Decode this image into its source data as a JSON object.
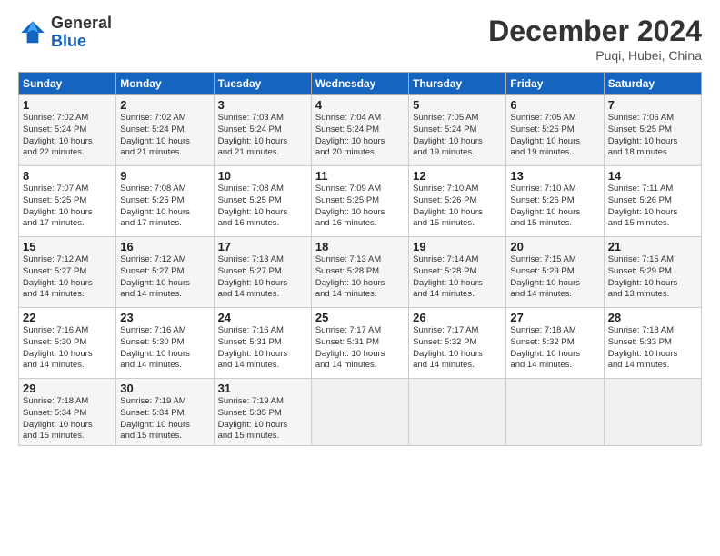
{
  "header": {
    "logo_general": "General",
    "logo_blue": "Blue",
    "month_title": "December 2024",
    "location": "Puqi, Hubei, China"
  },
  "days_of_week": [
    "Sunday",
    "Monday",
    "Tuesday",
    "Wednesday",
    "Thursday",
    "Friday",
    "Saturday"
  ],
  "weeks": [
    [
      {
        "day": "1",
        "info": "Sunrise: 7:02 AM\nSunset: 5:24 PM\nDaylight: 10 hours\nand 22 minutes."
      },
      {
        "day": "2",
        "info": "Sunrise: 7:02 AM\nSunset: 5:24 PM\nDaylight: 10 hours\nand 21 minutes."
      },
      {
        "day": "3",
        "info": "Sunrise: 7:03 AM\nSunset: 5:24 PM\nDaylight: 10 hours\nand 21 minutes."
      },
      {
        "day": "4",
        "info": "Sunrise: 7:04 AM\nSunset: 5:24 PM\nDaylight: 10 hours\nand 20 minutes."
      },
      {
        "day": "5",
        "info": "Sunrise: 7:05 AM\nSunset: 5:24 PM\nDaylight: 10 hours\nand 19 minutes."
      },
      {
        "day": "6",
        "info": "Sunrise: 7:05 AM\nSunset: 5:25 PM\nDaylight: 10 hours\nand 19 minutes."
      },
      {
        "day": "7",
        "info": "Sunrise: 7:06 AM\nSunset: 5:25 PM\nDaylight: 10 hours\nand 18 minutes."
      }
    ],
    [
      {
        "day": "8",
        "info": "Sunrise: 7:07 AM\nSunset: 5:25 PM\nDaylight: 10 hours\nand 17 minutes."
      },
      {
        "day": "9",
        "info": "Sunrise: 7:08 AM\nSunset: 5:25 PM\nDaylight: 10 hours\nand 17 minutes."
      },
      {
        "day": "10",
        "info": "Sunrise: 7:08 AM\nSunset: 5:25 PM\nDaylight: 10 hours\nand 16 minutes."
      },
      {
        "day": "11",
        "info": "Sunrise: 7:09 AM\nSunset: 5:25 PM\nDaylight: 10 hours\nand 16 minutes."
      },
      {
        "day": "12",
        "info": "Sunrise: 7:10 AM\nSunset: 5:26 PM\nDaylight: 10 hours\nand 15 minutes."
      },
      {
        "day": "13",
        "info": "Sunrise: 7:10 AM\nSunset: 5:26 PM\nDaylight: 10 hours\nand 15 minutes."
      },
      {
        "day": "14",
        "info": "Sunrise: 7:11 AM\nSunset: 5:26 PM\nDaylight: 10 hours\nand 15 minutes."
      }
    ],
    [
      {
        "day": "15",
        "info": "Sunrise: 7:12 AM\nSunset: 5:27 PM\nDaylight: 10 hours\nand 14 minutes."
      },
      {
        "day": "16",
        "info": "Sunrise: 7:12 AM\nSunset: 5:27 PM\nDaylight: 10 hours\nand 14 minutes."
      },
      {
        "day": "17",
        "info": "Sunrise: 7:13 AM\nSunset: 5:27 PM\nDaylight: 10 hours\nand 14 minutes."
      },
      {
        "day": "18",
        "info": "Sunrise: 7:13 AM\nSunset: 5:28 PM\nDaylight: 10 hours\nand 14 minutes."
      },
      {
        "day": "19",
        "info": "Sunrise: 7:14 AM\nSunset: 5:28 PM\nDaylight: 10 hours\nand 14 minutes."
      },
      {
        "day": "20",
        "info": "Sunrise: 7:15 AM\nSunset: 5:29 PM\nDaylight: 10 hours\nand 14 minutes."
      },
      {
        "day": "21",
        "info": "Sunrise: 7:15 AM\nSunset: 5:29 PM\nDaylight: 10 hours\nand 13 minutes."
      }
    ],
    [
      {
        "day": "22",
        "info": "Sunrise: 7:16 AM\nSunset: 5:30 PM\nDaylight: 10 hours\nand 14 minutes."
      },
      {
        "day": "23",
        "info": "Sunrise: 7:16 AM\nSunset: 5:30 PM\nDaylight: 10 hours\nand 14 minutes."
      },
      {
        "day": "24",
        "info": "Sunrise: 7:16 AM\nSunset: 5:31 PM\nDaylight: 10 hours\nand 14 minutes."
      },
      {
        "day": "25",
        "info": "Sunrise: 7:17 AM\nSunset: 5:31 PM\nDaylight: 10 hours\nand 14 minutes."
      },
      {
        "day": "26",
        "info": "Sunrise: 7:17 AM\nSunset: 5:32 PM\nDaylight: 10 hours\nand 14 minutes."
      },
      {
        "day": "27",
        "info": "Sunrise: 7:18 AM\nSunset: 5:32 PM\nDaylight: 10 hours\nand 14 minutes."
      },
      {
        "day": "28",
        "info": "Sunrise: 7:18 AM\nSunset: 5:33 PM\nDaylight: 10 hours\nand 14 minutes."
      }
    ],
    [
      {
        "day": "29",
        "info": "Sunrise: 7:18 AM\nSunset: 5:34 PM\nDaylight: 10 hours\nand 15 minutes."
      },
      {
        "day": "30",
        "info": "Sunrise: 7:19 AM\nSunset: 5:34 PM\nDaylight: 10 hours\nand 15 minutes."
      },
      {
        "day": "31",
        "info": "Sunrise: 7:19 AM\nSunset: 5:35 PM\nDaylight: 10 hours\nand 15 minutes."
      },
      {
        "day": "",
        "info": ""
      },
      {
        "day": "",
        "info": ""
      },
      {
        "day": "",
        "info": ""
      },
      {
        "day": "",
        "info": ""
      }
    ]
  ]
}
